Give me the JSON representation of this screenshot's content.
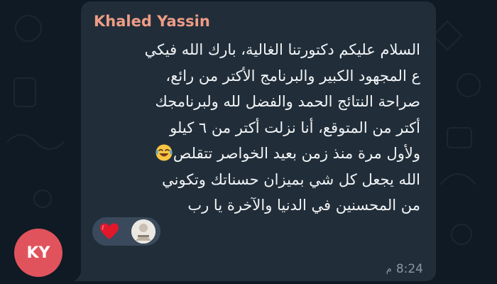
{
  "message": {
    "sender_name": "Khaled Yassin",
    "lines": [
      "السلام عليكم دكتورتنا الغالية، بارك الله فيكي",
      "ع المجهود الكبير والبرنامج الأكتر من رائع،",
      "صراحة النتائج الحمد والفضل لله ولبرنامجك",
      "أكتر من المتوقع، أنا نزلت أكتر من ٦ كيلو",
      "ولأول مرة منذ زمن بعيد الخواصر تتقلص",
      "الله يجعل كل شي بميزان حسناتك وتكوني",
      "من المحسنين في الدنيا والآخرة يا رب"
    ],
    "emoji_icon": "laughing-tears-emoji-icon",
    "time": "8:24",
    "period": "م"
  },
  "reactions": [
    {
      "icon": "red-heart-icon"
    },
    {
      "icon": "reactor-avatar"
    }
  ],
  "avatar": {
    "initials": "KY",
    "color": "#e1535c"
  },
  "colors": {
    "background": "#0f1a24",
    "bubble": "#212e3a",
    "sender_name": "#ee9c86",
    "text": "#f2f4f6",
    "meta": "#8a97a4",
    "reaction_pill": "#3a4a5c"
  }
}
